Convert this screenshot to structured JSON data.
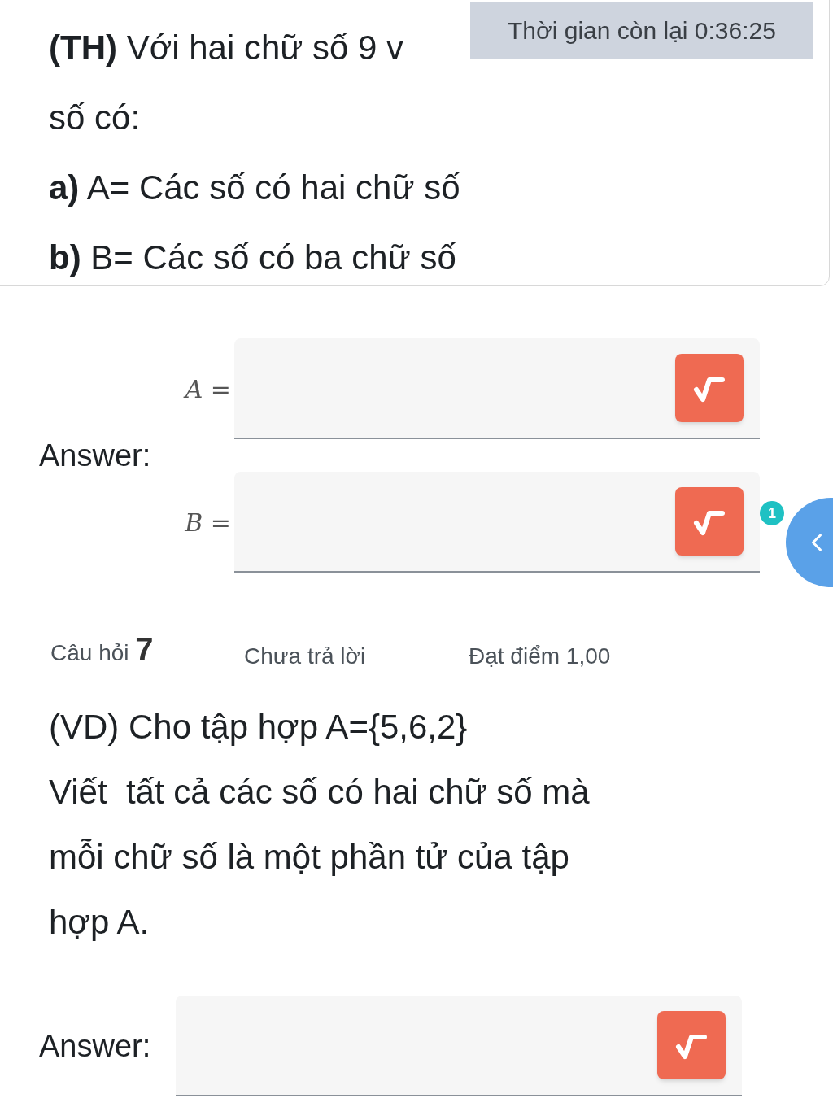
{
  "timer": {
    "label": "Thời gian còn lại 0:36:25"
  },
  "question_6": {
    "lines": [
      "**(TH)** Với hai chữ số 9 v",
      "số có:",
      "**a)** A= Các số có hai chữ số",
      "**b)** B= Các số có ba chữ số"
    ],
    "answer_label": "Answer:",
    "fields": [
      {
        "label": "A ="
      },
      {
        "label": "B ="
      }
    ]
  },
  "side_tab": {
    "badge": "1"
  },
  "question_7": {
    "label": "Câu hỏi",
    "number": "7",
    "status": "Chưa trả lời",
    "points": "Đạt điểm 1,00",
    "lines": [
      "(VD) Cho tập hợp A={5,6,2}",
      "Viết  tất cả các số có hai chữ số mà mỗi chữ số là một phần tử của tập hợp A."
    ],
    "answer_label": "Answer:"
  }
}
